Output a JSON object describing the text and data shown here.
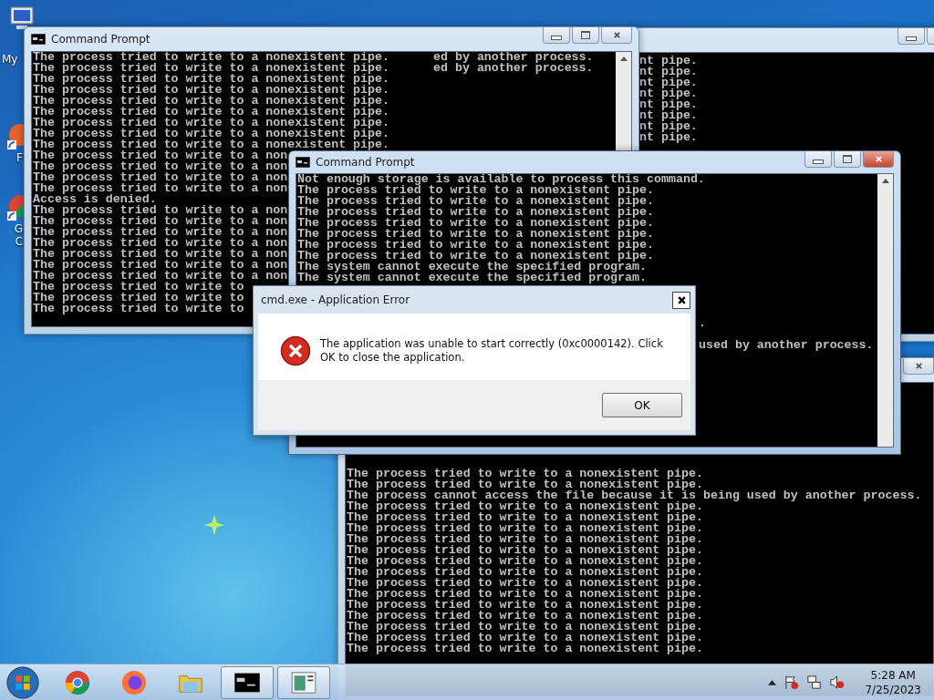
{
  "desktop_icons": [
    {
      "kind": "computer",
      "label": "My"
    },
    {
      "kind": "orange-shortcut",
      "label": "F"
    },
    {
      "kind": "chrome-shortcut",
      "label": "G C"
    }
  ],
  "back_window_right": {
    "active": false,
    "lines": [
      "nt pipe.",
      "nt pipe.",
      "nt pipe.",
      "nt pipe.",
      "nt pipe.",
      "nt pipe.",
      "nt pipe.",
      "nt pipe."
    ]
  },
  "back_window_left": {
    "title": "Command Prompt",
    "active": false,
    "lines": [
      {
        "text": "The process tried to write to a nonexistent pipe.",
        "tail": "ed by another process."
      },
      {
        "text": "The process tried to write to a nonexistent pipe.",
        "tail": "ed by another process."
      },
      {
        "text": "The process tried to write to a nonexistent pipe."
      },
      {
        "text": "The process tried to write to a nonexistent pipe."
      },
      {
        "text": "The process tried to write to a nonexistent pipe."
      },
      {
        "text": "The process tried to write to a nonexistent pipe."
      },
      {
        "text": "The process tried to write to a nonexistent pipe."
      },
      {
        "text": "The process tried to write to a nonexistent pipe."
      },
      {
        "text": "The process tried to write to a nonexistent pipe."
      },
      {
        "text": "The process tried to write to a non"
      },
      {
        "text": "The process tried to write to a non"
      },
      {
        "text": "The process tried to write to a non"
      },
      {
        "text": "The process tried to write to a non"
      },
      {
        "text": "Access is denied."
      },
      {
        "text": "The process tried to write to a non"
      },
      {
        "text": "The process tried to write to a non"
      },
      {
        "text": "The process tried to write to a non"
      },
      {
        "text": "The process tried to write to a non"
      },
      {
        "text": "The process tried to write to a non"
      },
      {
        "text": "The process tried to write to a non"
      },
      {
        "text": "The process tried to write to a non"
      },
      {
        "text": "The process tried to write to"
      },
      {
        "text": "The process tried to write to"
      },
      {
        "text": "The process tried to write to"
      }
    ]
  },
  "back_window_bottom": {
    "active": false,
    "lines": [
      "The process tried to write to a nonexistent pipe.",
      "The process tried to write to a nonexistent pipe.",
      "The process cannot access the file because it is being used by another process.",
      "The process tried to write to a nonexistent pipe.",
      "The process tried to write to a nonexistent pipe.",
      "The process tried to write to a nonexistent pipe.",
      "The process tried to write to a nonexistent pipe.",
      "The process tried to write to a nonexistent pipe.",
      "The process tried to write to a nonexistent pipe.",
      "The process tried to write to a nonexistent pipe.",
      "The process tried to write to a nonexistent pipe.",
      "The process tried to write to a nonexistent pipe.",
      "The process tried to write to a nonexistent pipe.",
      "The process tried to write to a nonexistent pipe.",
      "The process tried to write to a nonexistent pipe.",
      "The process tried to write to a nonexistent pipe.",
      "The process tried to write to a nonexistent pipe."
    ]
  },
  "front_window": {
    "title": "Command Prompt",
    "active": true,
    "lines": [
      "Not enough storage is available to process this command.",
      "The process tried to write to a nonexistent pipe.",
      "The process tried to write to a nonexistent pipe.",
      "The process tried to write to a nonexistent pipe.",
      "The process tried to write to a nonexistent pipe.",
      "The process tried to write to a nonexistent pipe.",
      "The process tried to write to a nonexistent pipe.",
      "The process tried to write to a nonexistent pipe.",
      "The system cannot execute the specified program.",
      "The system cannot execute the specified program."
    ],
    "covered_tail": [
      ".",
      "used by another process."
    ]
  },
  "error_dialog": {
    "title": "cmd.exe - Application Error",
    "message": "The application was unable to start correctly (0xc0000142). Click OK to close the application.",
    "button": "OK"
  },
  "taskbar": {
    "apps": [
      {
        "kind": "chrome",
        "running": false
      },
      {
        "kind": "firefox",
        "running": false
      },
      {
        "kind": "folder",
        "running": false
      },
      {
        "kind": "console",
        "running": true
      },
      {
        "kind": "document",
        "running": true
      }
    ],
    "tray": [
      {
        "kind": "arrow"
      },
      {
        "kind": "flag"
      },
      {
        "kind": "network"
      },
      {
        "kind": "speaker"
      }
    ],
    "time": "5:28 AM",
    "date": "7/25/2023"
  }
}
